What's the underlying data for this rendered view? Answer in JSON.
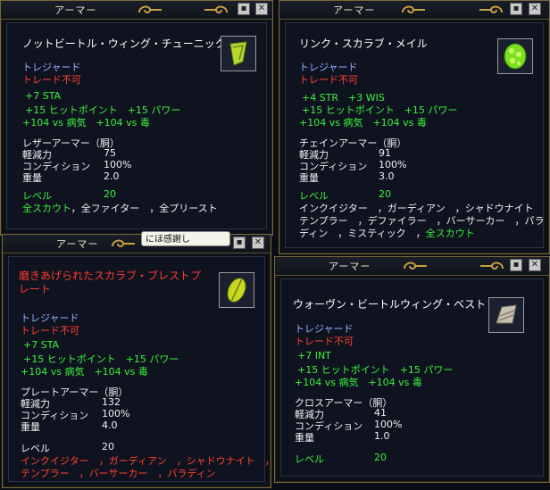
{
  "windows": [
    {
      "title": "アーマー",
      "item_name": "ノットビートル・ウィング・チューニック",
      "treasure": "トレジャード",
      "no_trade": "トレード不可",
      "stats": [
        "+7 STA",
        "+15 ヒットポイント　+15 パワー",
        "+104 vs 病気　+104 vs 毒"
      ],
      "armor_type": "レザーアーマー（胴）",
      "mitigation_label": "軽減力",
      "mitigation": "75",
      "condition_label": "コンディション",
      "condition": "100%",
      "weight_label": "重量",
      "weight": "2.0",
      "level_label": "レベル",
      "level": "20",
      "classes_green": "全スカウト",
      "classes_white": "，全ファイター　，全プリースト"
    },
    {
      "title": "アーマー",
      "item_name": "リンク・スカラブ・メイル",
      "treasure": "トレジャード",
      "no_trade": "トレード不可",
      "stats": [
        "+4 STR　+3 WIS",
        "+15 ヒットポイント　+15 パワー",
        "+104 vs 病気　+104 vs 毒"
      ],
      "armor_type": "チェインアーマー（胴）",
      "mitigation_label": "軽減力",
      "mitigation": "91",
      "condition_label": "コンディション",
      "condition": "100%",
      "weight_label": "重量",
      "weight": "3.0",
      "level_label": "レベル",
      "level": "20",
      "classes_line1": "インクイジター　，ガーディアン　，シャドウナイト",
      "classes_line2": "テンプラー　，デファイラー　，バーサーカー　，パラ",
      "classes_line3_white": "ディン　，ミスティック　，",
      "classes_line3_green": "全スカウト"
    },
    {
      "title": "アーマー",
      "item_name": "磨きあげられたスカラブ・ブレストプレート",
      "treasure": "トレジャード",
      "no_trade": "トレード不可",
      "stats": [
        "+7 STA",
        "+15 ヒットポイント　+15 パワー",
        "+104 vs 病気　+104 vs 毒"
      ],
      "armor_type": "プレートアーマー（胴）",
      "mitigation_label": "軽減力",
      "mitigation": "132",
      "condition_label": "コンディション",
      "condition": "100%",
      "weight_label": "重量",
      "weight": "4.0",
      "level_label": "レベル",
      "level": "20",
      "classes_line1": "インクイジター　，ガーディアン　，シャドウナイト　，",
      "classes_line2": "テンプラー　，バーサーカー　，パラディン"
    },
    {
      "title": "アーマー",
      "item_name": "ウォーヴン・ビートルウィング・ベスト",
      "treasure": "トレジャード",
      "no_trade": "トレード不可",
      "stats": [
        "+7 INT",
        "+15 ヒットポイント　+15 パワー",
        "+104 vs 病気　+104 vs 毒"
      ],
      "armor_type": "クロスアーマー（胴）",
      "mitigation_label": "軽減力",
      "mitigation": "41",
      "condition_label": "コンディション",
      "condition": "100%",
      "weight_label": "重量",
      "weight": "1.0",
      "level_label": "レベル",
      "level": "20"
    }
  ],
  "tooltip": "にほ感謝し",
  "buttons": {
    "minimize": "▪",
    "close": "✕"
  },
  "colors": {
    "green": "#3cf03c",
    "red": "#ff4030",
    "treasure": "#8fb0ff",
    "gold_border": "#7a6a3c"
  }
}
